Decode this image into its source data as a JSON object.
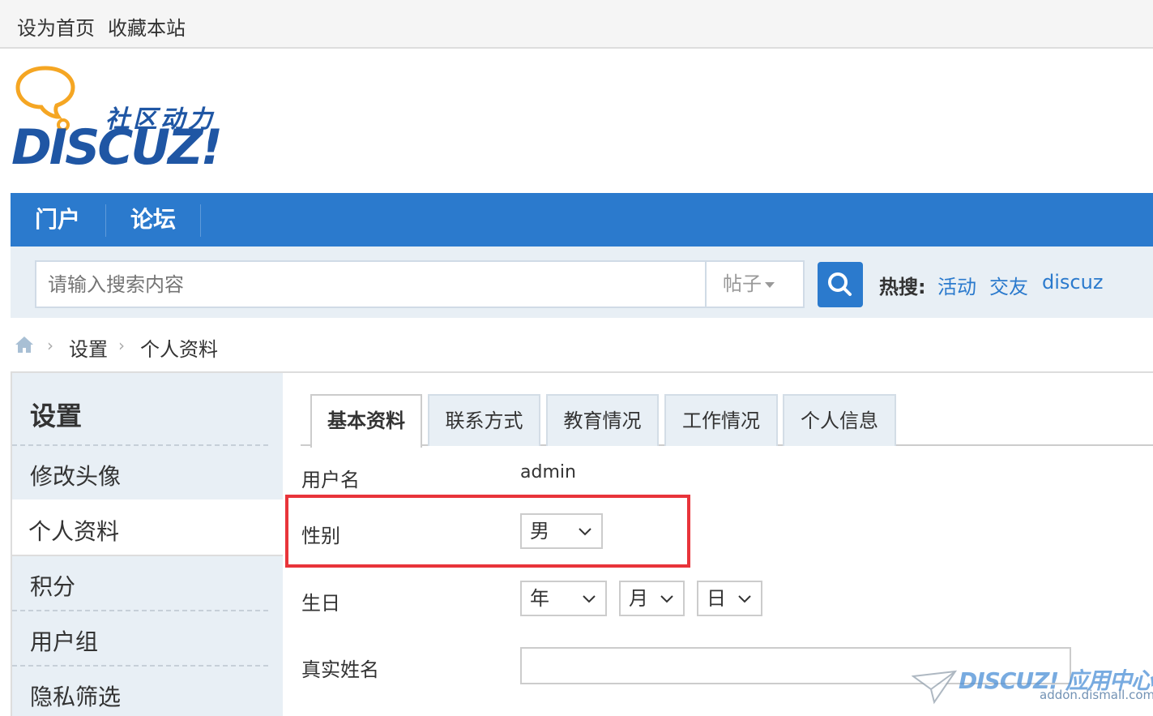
{
  "topbar": {
    "set_home": "设为首页",
    "bookmark": "收藏本站"
  },
  "logo": {
    "subtitle": "社区动力",
    "brand": "DISCUZ!"
  },
  "nav": {
    "items": [
      {
        "label": "门户"
      },
      {
        "label": "论坛"
      }
    ]
  },
  "search": {
    "placeholder": "请输入搜索内容",
    "type_label": "帖子",
    "hot_label": "热搜:",
    "hot_links": [
      "活动",
      "交友",
      "discuz"
    ]
  },
  "breadcrumb": {
    "items": [
      "设置",
      "个人资料"
    ]
  },
  "sidebar": {
    "title": "设置",
    "items": [
      {
        "label": "修改头像"
      },
      {
        "label": "个人资料",
        "active": true
      },
      {
        "label": "积分"
      },
      {
        "label": "用户组"
      },
      {
        "label": "隐私筛选"
      }
    ]
  },
  "tabs": [
    {
      "label": "基本资料",
      "active": true
    },
    {
      "label": "联系方式"
    },
    {
      "label": "教育情况"
    },
    {
      "label": "工作情况"
    },
    {
      "label": "个人信息"
    }
  ],
  "form": {
    "username_label": "用户名",
    "username_value": "admin",
    "gender_label": "性别",
    "gender_value": "男",
    "birthday_label": "生日",
    "birthday_year": "年",
    "birthday_month": "月",
    "birthday_day": "日",
    "realname_label": "真实姓名",
    "realname_value": ""
  },
  "watermark": {
    "brand": "DISCUZ! 应用中心",
    "url": "addon.dismall.com"
  },
  "colors": {
    "nav": "#2b7acd",
    "highlight": "#e8343a",
    "brand": "#1f56a4"
  }
}
